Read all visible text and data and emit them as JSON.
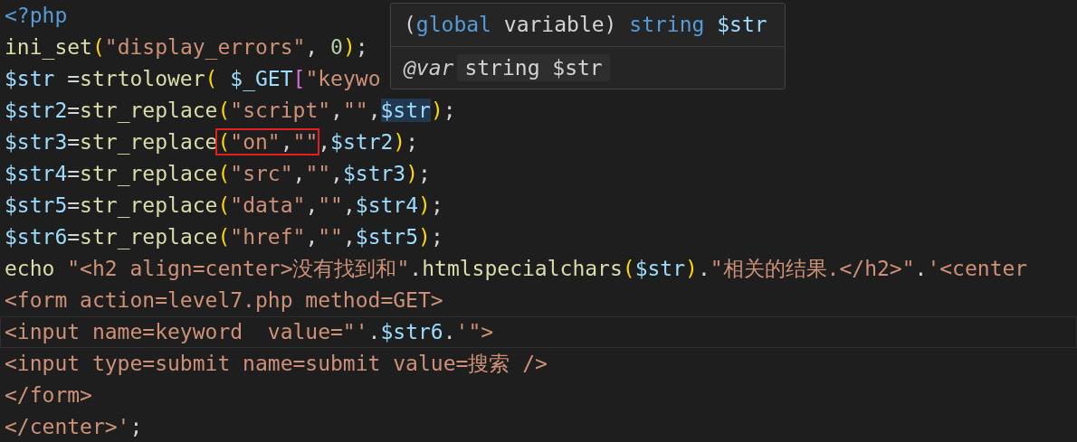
{
  "editor": {
    "lines": [
      {
        "current": false,
        "tokens": [
          {
            "text": "<?php",
            "kind": "keyword"
          }
        ]
      },
      {
        "current": false,
        "tokens": [
          {
            "text": "ini_set",
            "kind": "func"
          },
          {
            "text": "(",
            "kind": "bracket"
          },
          {
            "text": "\"display_errors\"",
            "kind": "string"
          },
          {
            "text": ", ",
            "kind": "plain"
          },
          {
            "text": "0",
            "kind": "number"
          },
          {
            "text": ")",
            "kind": "bracket"
          },
          {
            "text": ";",
            "kind": "plain"
          }
        ]
      },
      {
        "current": false,
        "tokens": [
          {
            "text": "$str",
            "kind": "var"
          },
          {
            "text": " =",
            "kind": "plain"
          },
          {
            "text": "strtolower",
            "kind": "func"
          },
          {
            "text": "( ",
            "kind": "bracket"
          },
          {
            "text": "$_GET",
            "kind": "var"
          },
          {
            "text": "[",
            "kind": "bracket2"
          },
          {
            "text": "\"keywo",
            "kind": "string"
          }
        ]
      },
      {
        "current": false,
        "tokens": [
          {
            "text": "$str2",
            "kind": "var"
          },
          {
            "text": "=",
            "kind": "plain"
          },
          {
            "text": "str_replace",
            "kind": "func"
          },
          {
            "text": "(",
            "kind": "bracket"
          },
          {
            "text": "\"script\"",
            "kind": "string"
          },
          {
            "text": ",",
            "kind": "plain"
          },
          {
            "text": "\"\"",
            "kind": "string"
          },
          {
            "text": ",",
            "kind": "plain"
          },
          {
            "text": "$str",
            "kind": "var",
            "highlighted": true
          },
          {
            "text": ")",
            "kind": "bracket"
          },
          {
            "text": ";",
            "kind": "plain"
          }
        ]
      },
      {
        "current": false,
        "tokens": [
          {
            "text": "$str3",
            "kind": "var"
          },
          {
            "text": "=",
            "kind": "plain"
          },
          {
            "text": "str_replace",
            "kind": "func"
          },
          {
            "text": "(",
            "kind": "bracket",
            "framed": true
          },
          {
            "text": "\"on\"",
            "kind": "string",
            "framed": true
          },
          {
            "text": ",",
            "kind": "plain",
            "framed": true
          },
          {
            "text": "\"\"",
            "kind": "string",
            "framed": true
          },
          {
            "text": ",",
            "kind": "plain"
          },
          {
            "text": "$str2",
            "kind": "var"
          },
          {
            "text": ")",
            "kind": "bracket"
          },
          {
            "text": ";",
            "kind": "plain"
          }
        ]
      },
      {
        "current": false,
        "tokens": [
          {
            "text": "$str4",
            "kind": "var"
          },
          {
            "text": "=",
            "kind": "plain"
          },
          {
            "text": "str_replace",
            "kind": "func"
          },
          {
            "text": "(",
            "kind": "bracket"
          },
          {
            "text": "\"src\"",
            "kind": "string"
          },
          {
            "text": ",",
            "kind": "plain"
          },
          {
            "text": "\"\"",
            "kind": "string"
          },
          {
            "text": ",",
            "kind": "plain"
          },
          {
            "text": "$str3",
            "kind": "var"
          },
          {
            "text": ")",
            "kind": "bracket"
          },
          {
            "text": ";",
            "kind": "plain"
          }
        ]
      },
      {
        "current": false,
        "tokens": [
          {
            "text": "$str5",
            "kind": "var"
          },
          {
            "text": "=",
            "kind": "plain"
          },
          {
            "text": "str_replace",
            "kind": "func"
          },
          {
            "text": "(",
            "kind": "bracket"
          },
          {
            "text": "\"data\"",
            "kind": "string"
          },
          {
            "text": ",",
            "kind": "plain"
          },
          {
            "text": "\"\"",
            "kind": "string"
          },
          {
            "text": ",",
            "kind": "plain"
          },
          {
            "text": "$str4",
            "kind": "var"
          },
          {
            "text": ")",
            "kind": "bracket"
          },
          {
            "text": ";",
            "kind": "plain"
          }
        ]
      },
      {
        "current": false,
        "tokens": [
          {
            "text": "$str6",
            "kind": "var"
          },
          {
            "text": "=",
            "kind": "plain"
          },
          {
            "text": "str_replace",
            "kind": "func"
          },
          {
            "text": "(",
            "kind": "bracket"
          },
          {
            "text": "\"href\"",
            "kind": "string"
          },
          {
            "text": ",",
            "kind": "plain"
          },
          {
            "text": "\"\"",
            "kind": "string"
          },
          {
            "text": ",",
            "kind": "plain"
          },
          {
            "text": "$str5",
            "kind": "var"
          },
          {
            "text": ")",
            "kind": "bracket"
          },
          {
            "text": ";",
            "kind": "plain"
          }
        ]
      },
      {
        "current": false,
        "tokens": [
          {
            "text": "echo ",
            "kind": "func"
          },
          {
            "text": "\"<h2 align=center>没有找到和\"",
            "kind": "string"
          },
          {
            "text": ".",
            "kind": "plain"
          },
          {
            "text": "htmlspecialchars",
            "kind": "func"
          },
          {
            "text": "(",
            "kind": "bracket"
          },
          {
            "text": "$str",
            "kind": "var"
          },
          {
            "text": ")",
            "kind": "bracket"
          },
          {
            "text": ".",
            "kind": "plain"
          },
          {
            "text": "\"相关的结果.</h2>\"",
            "kind": "string"
          },
          {
            "text": ".",
            "kind": "plain"
          },
          {
            "text": "'<center",
            "kind": "string"
          }
        ]
      },
      {
        "current": false,
        "tokens": [
          {
            "text": "<form action=level7.php method=GET>",
            "kind": "string"
          }
        ]
      },
      {
        "current": true,
        "tokens": [
          {
            "text": "<input name=keyword  value=\"'",
            "kind": "string"
          },
          {
            "text": ".",
            "kind": "plain"
          },
          {
            "text": "$str6",
            "kind": "var"
          },
          {
            "text": ".",
            "kind": "plain"
          },
          {
            "text": "'\">",
            "kind": "string"
          }
        ]
      },
      {
        "current": false,
        "tokens": [
          {
            "text": "<input type=submit name=submit value=搜索 />",
            "kind": "string"
          }
        ]
      },
      {
        "current": false,
        "tokens": [
          {
            "text": "</form>",
            "kind": "string"
          }
        ]
      },
      {
        "current": false,
        "tokens": [
          {
            "text": "</center>'",
            "kind": "string"
          },
          {
            "text": ";",
            "kind": "plain"
          }
        ]
      }
    ]
  },
  "tooltip": {
    "signature": [
      {
        "text": "(",
        "kind": "plain"
      },
      {
        "text": "global",
        "kind": "keyword"
      },
      {
        "text": " variable) ",
        "kind": "plain"
      },
      {
        "text": "string",
        "kind": "keyword"
      },
      {
        "text": " $str",
        "kind": "var"
      }
    ],
    "doc_tag": "@var",
    "doc_code": "string $str"
  }
}
